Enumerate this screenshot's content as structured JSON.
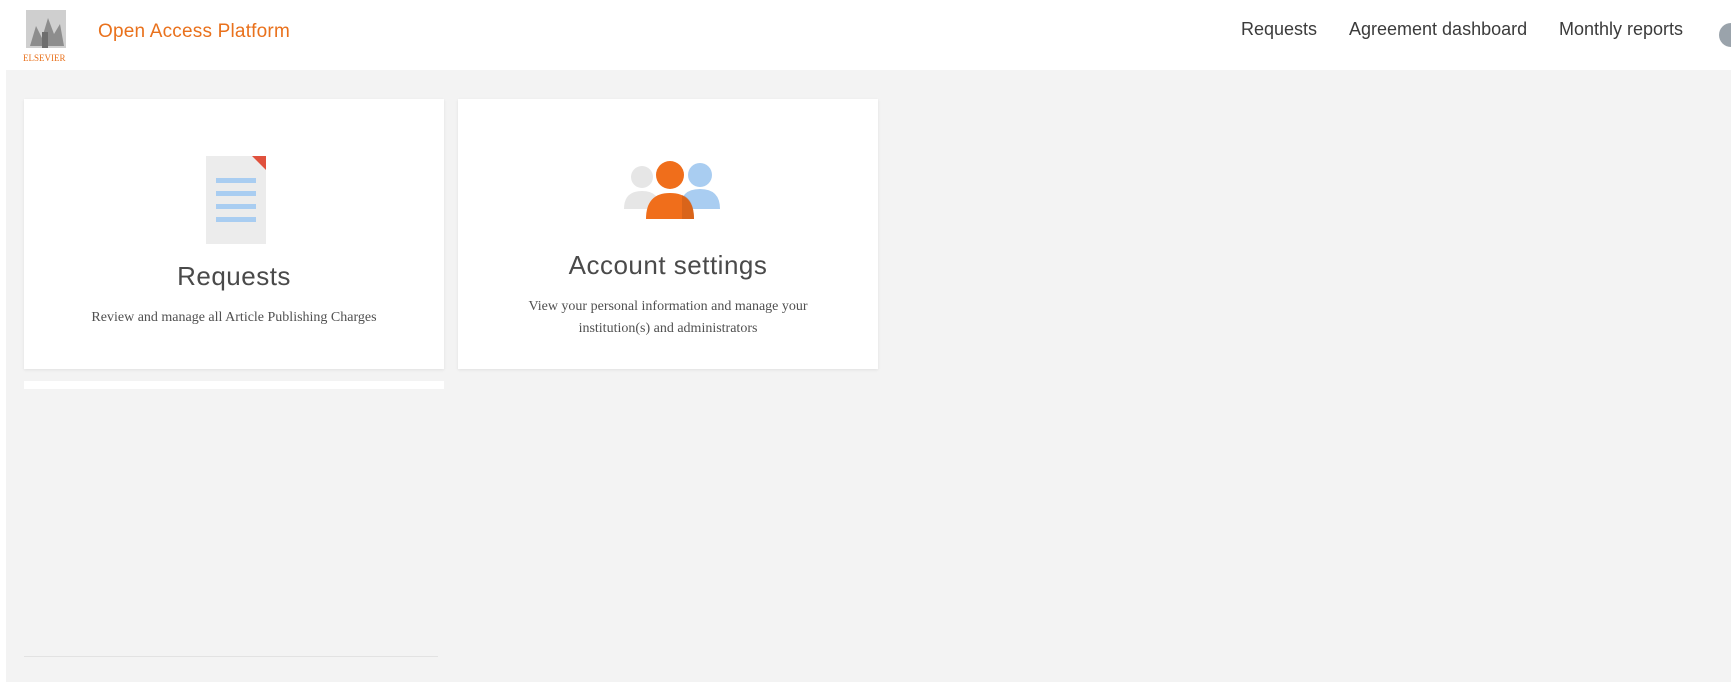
{
  "header": {
    "brand_text": "Open Access Platform",
    "logo_text": "ELSEVIER",
    "nav": {
      "requests": "Requests",
      "agreement_dashboard": "Agreement dashboard",
      "monthly_reports": "Monthly reports"
    },
    "accent_color": "#e9711c"
  },
  "cards": {
    "requests": {
      "title": "Requests",
      "description": "Review and manage all Article Publishing Charges",
      "icon": "document-icon"
    },
    "account_settings": {
      "title": "Account settings",
      "description": "View your personal information and manage your institution(s) and administrators",
      "icon": "people-icon"
    }
  }
}
